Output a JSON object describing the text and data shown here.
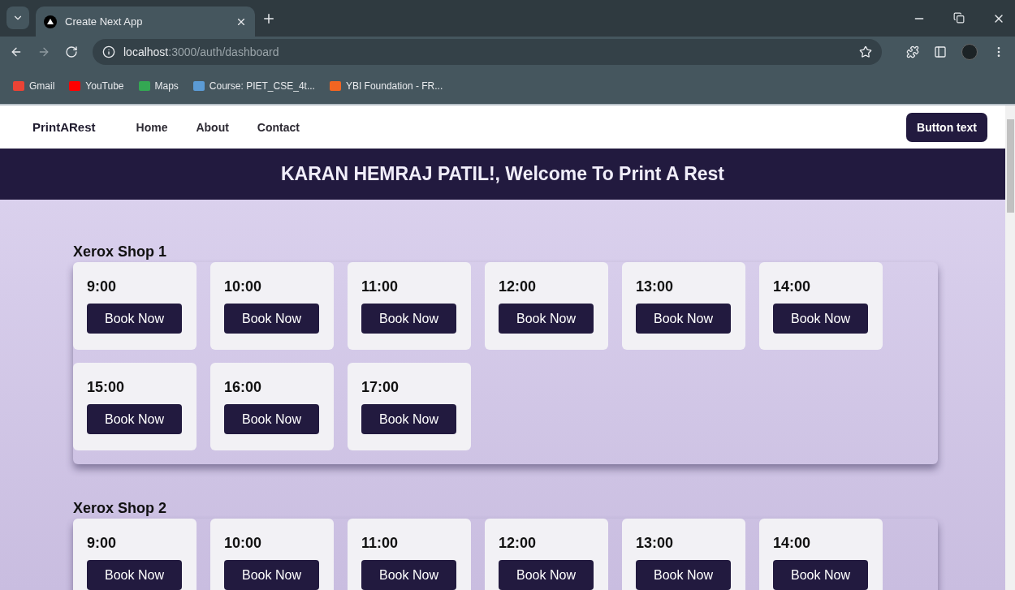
{
  "browser": {
    "tab_title": "Create Next App",
    "url_host": "localhost",
    "url_path": ":3000/auth/dashboard",
    "bookmarks": [
      {
        "label": "Gmail",
        "color": "#ea4335"
      },
      {
        "label": "YouTube",
        "color": "#ff0000"
      },
      {
        "label": "Maps",
        "color": "#34a853"
      },
      {
        "label": "Course: PIET_CSE_4t...",
        "color": "#5b9bd5"
      },
      {
        "label": "YBI Foundation - FR...",
        "color": "#f26522"
      }
    ]
  },
  "navbar": {
    "brand": "PrintARest",
    "links": [
      "Home",
      "About",
      "Contact"
    ],
    "button": "Button text"
  },
  "banner": {
    "title": "KARAN HEMRAJ PATIL!, Welcome To Print A Rest"
  },
  "shops": [
    {
      "name": "Xerox Shop 1",
      "slots": [
        {
          "time": "9:00",
          "action": "Book Now"
        },
        {
          "time": "10:00",
          "action": "Book Now"
        },
        {
          "time": "11:00",
          "action": "Book Now"
        },
        {
          "time": "12:00",
          "action": "Book Now"
        },
        {
          "time": "13:00",
          "action": "Book Now"
        },
        {
          "time": "14:00",
          "action": "Book Now"
        },
        {
          "time": "15:00",
          "action": "Book Now"
        },
        {
          "time": "16:00",
          "action": "Book Now"
        },
        {
          "time": "17:00",
          "action": "Book Now"
        }
      ]
    },
    {
      "name": "Xerox Shop 2",
      "slots": [
        {
          "time": "9:00",
          "action": "Book Now"
        },
        {
          "time": "10:00",
          "action": "Book Now"
        },
        {
          "time": "11:00",
          "action": "Book Now"
        },
        {
          "time": "12:00",
          "action": "Book Now"
        },
        {
          "time": "13:00",
          "action": "Book Now"
        },
        {
          "time": "14:00",
          "action": "Book Now"
        }
      ]
    }
  ]
}
